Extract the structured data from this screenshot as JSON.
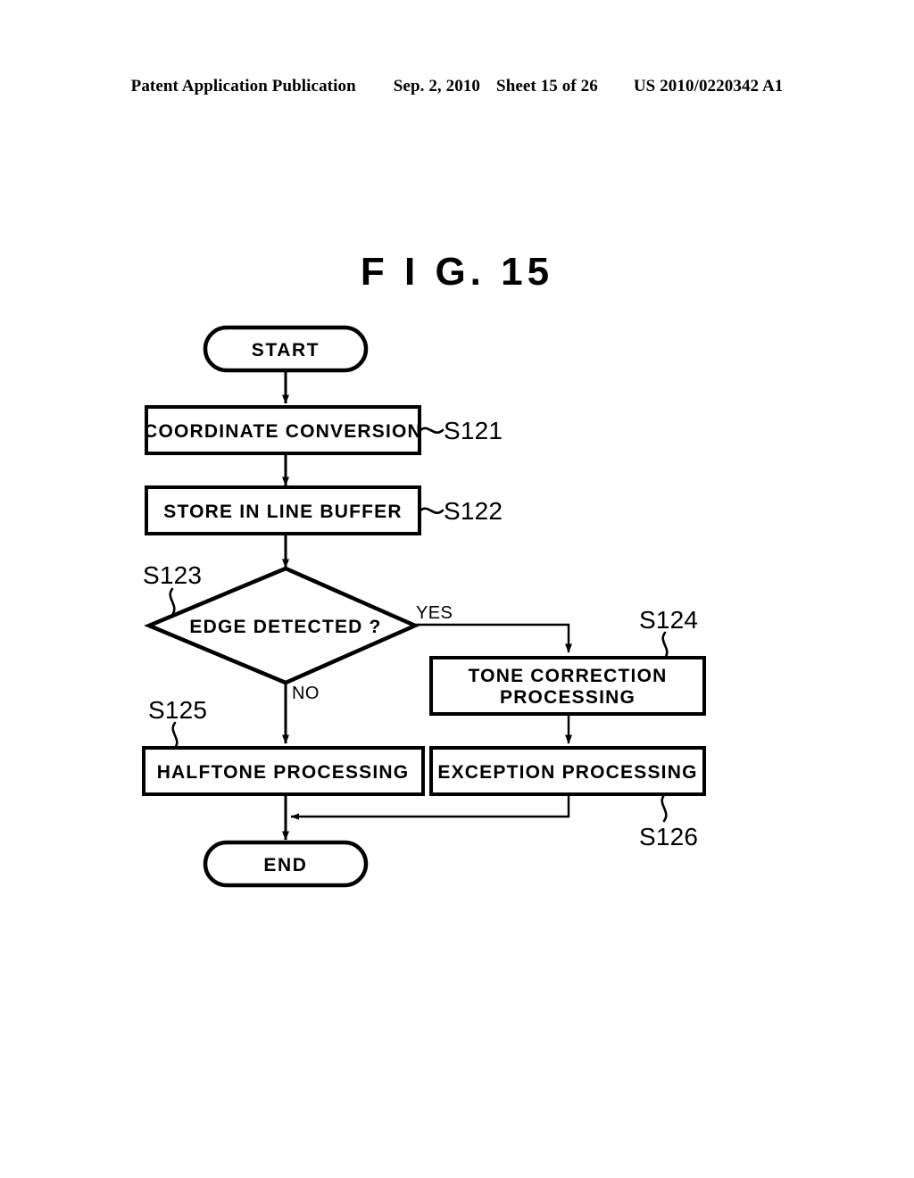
{
  "header": {
    "publication": "Patent Application Publication",
    "date": "Sep. 2, 2010",
    "sheet": "Sheet 15 of 26",
    "doc_number": "US 2010/0220342 A1"
  },
  "figure": {
    "title": "F I G.  15"
  },
  "flowchart": {
    "nodes": {
      "start": {
        "label": "START",
        "shape": "terminator"
      },
      "coordinate_conversion": {
        "label": "COORDINATE CONVERSION",
        "shape": "process",
        "step": "S121"
      },
      "store_in_line_buffer": {
        "label": "STORE IN LINE BUFFER",
        "shape": "process",
        "step": "S122"
      },
      "edge_detected": {
        "label": "EDGE DETECTED ?",
        "shape": "decision",
        "step": "S123"
      },
      "tone_correction": {
        "label_line1": "TONE CORRECTION",
        "label_line2": "PROCESSING",
        "shape": "process",
        "step": "S124"
      },
      "halftone": {
        "label": "HALFTONE PROCESSING",
        "shape": "process",
        "step": "S125"
      },
      "exception": {
        "label": "EXCEPTION PROCESSING",
        "shape": "process",
        "step": "S126"
      },
      "end": {
        "label": "END",
        "shape": "terminator"
      }
    },
    "edge_labels": {
      "yes": "YES",
      "no": "NO"
    },
    "steps": {
      "s121": "S121",
      "s122": "S122",
      "s123": "S123",
      "s124": "S124",
      "s125": "S125",
      "s126": "S126"
    },
    "colors": {
      "line": "#000000",
      "fill": "#ffffff"
    }
  }
}
